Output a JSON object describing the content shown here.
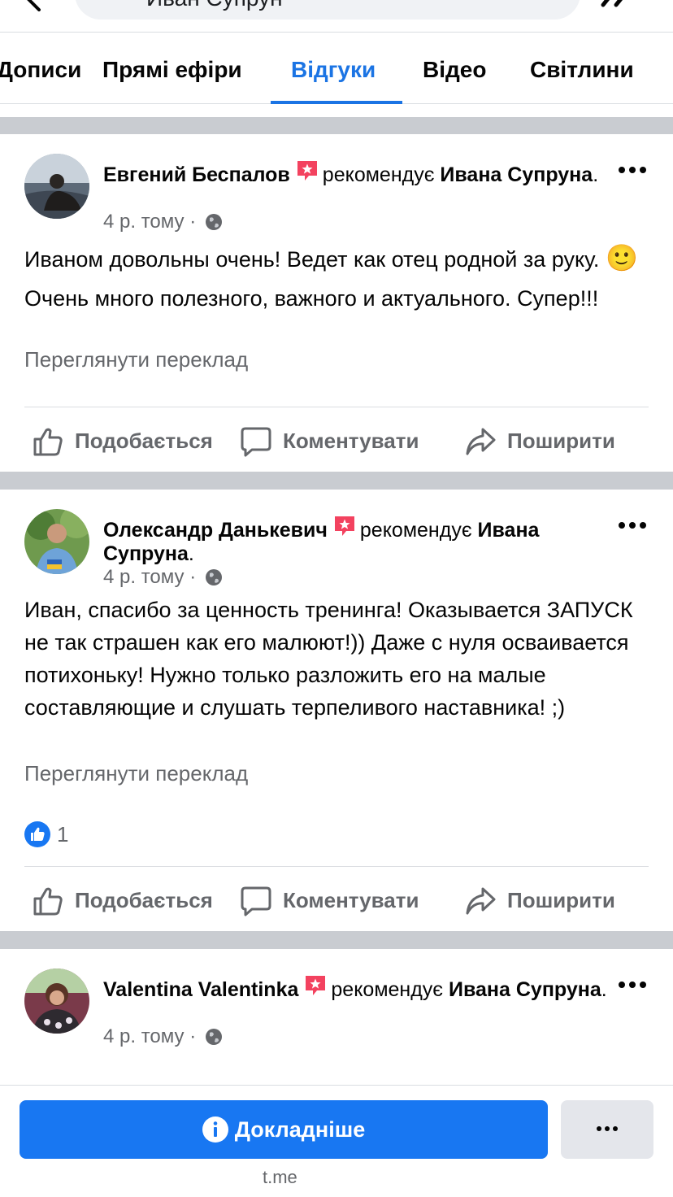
{
  "search": {
    "query": "Иван Супрун"
  },
  "tabs": [
    {
      "label": "Дописи"
    },
    {
      "label": "Прямі ефіри"
    },
    {
      "label": "Відгуки"
    },
    {
      "label": "Відео"
    },
    {
      "label": "Світлини"
    }
  ],
  "active_tab": "Відгуки",
  "colors": {
    "accent": "#1b74e4",
    "cta": "#1877f2",
    "badge": "#f3425f",
    "separator": "#c9ccd1"
  },
  "posts": [
    {
      "author": "Евгений Беспалов",
      "recommends": "рекомендує",
      "target": "Ивана Супруна",
      "period": ".",
      "time": "4 р. тому",
      "dot": "·",
      "body_1": "Иваном довольны очень! Ведет как отец родной за руку.",
      "emoji": "🙂",
      "body_2": "Очень много полезного, важного и актуального. Супер!!!",
      "translate": "Переглянути переклад",
      "actions": {
        "like": "Подобається",
        "comment": "Коментувати",
        "share": "Поширити"
      }
    },
    {
      "author": "Олександр Данькевич",
      "recommends": "рекомендує",
      "target": "Ивана Супруна",
      "period": ".",
      "time": "4 р. тому",
      "dot": "·",
      "body_1": "Иван, спасибо за ценность тренинга! Оказывается ЗАПУСК  не так страшен как его малюют!)) Даже с нуля осваивается потихоньку! Нужно только разложить его на малые составляющие и слушать терпеливого наставника! ;)",
      "translate": "Переглянути переклад",
      "likes": "1",
      "actions": {
        "like": "Подобається",
        "comment": "Коментувати",
        "share": "Поширити"
      }
    },
    {
      "author": "Valentina Valentinka",
      "recommends": "рекомендує",
      "target": "Ивана Супруна",
      "period": ".",
      "time": "4 р. тому",
      "dot": "·"
    }
  ],
  "bottom": {
    "cta_label": "Докладніше",
    "source": "t.me"
  }
}
